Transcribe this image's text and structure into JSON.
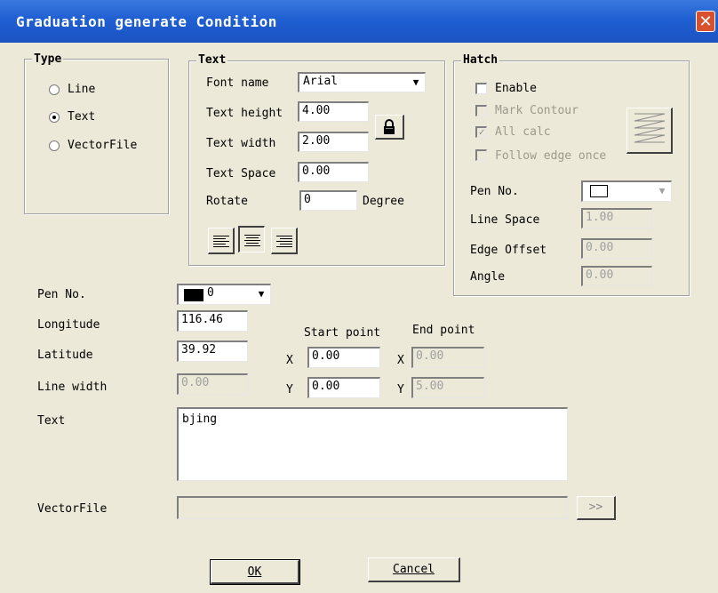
{
  "window": {
    "title": "Graduation generate Condition",
    "close_glyph": "✕"
  },
  "type_group": {
    "title": "Type",
    "options": [
      {
        "label": "Line",
        "selected": false
      },
      {
        "label": "Text",
        "selected": true
      },
      {
        "label": "VectorFile",
        "selected": false
      }
    ]
  },
  "text_group": {
    "title": "Text",
    "font_name_label": "Font name",
    "font_name_value": "Arial",
    "text_height_label": "Text height",
    "text_height_value": "4.00",
    "text_width_label": "Text width",
    "text_width_value": "2.00",
    "text_space_label": "Text Space",
    "text_space_value": "0.00",
    "rotate_label": "Rotate",
    "rotate_value": "0",
    "rotate_unit": "Degree",
    "align_selected": "center"
  },
  "hatch_group": {
    "title": "Hatch",
    "enable_label": "Enable",
    "mark_contour_label": "Mark Contour",
    "all_calc_label": "All calc",
    "follow_edge_label": "Follow edge once",
    "pen_no_label": "Pen No.",
    "line_space_label": "Line Space",
    "line_space_value": "1.00",
    "edge_offset_label": "Edge Offset",
    "edge_offset_value": "0.00",
    "angle_label": "Angle",
    "angle_value": "0.00"
  },
  "main": {
    "pen_no_label": "Pen No.",
    "pen_no_value": "0",
    "longitude_label": "Longitude",
    "longitude_value": "116.46",
    "latitude_label": "Latitude",
    "latitude_value": "39.92",
    "line_width_label": "Line width",
    "line_width_value": "0.00",
    "start_point_label": "Start point",
    "end_point_label": "End point",
    "x_label": "X",
    "y_label": "Y",
    "start_x": "0.00",
    "start_y": "0.00",
    "end_x": "0.00",
    "end_y": "5.00",
    "text_label": "Text",
    "text_value": "bjing",
    "vectorfile_label": "VectorFile",
    "vectorfile_value": "",
    "browse_label": ">>"
  },
  "buttons": {
    "ok": "OK",
    "cancel": "Cancel"
  },
  "colors": {
    "titlebar": "#1f5fd2",
    "face": "#ece9d8",
    "close": "#d8512e"
  }
}
